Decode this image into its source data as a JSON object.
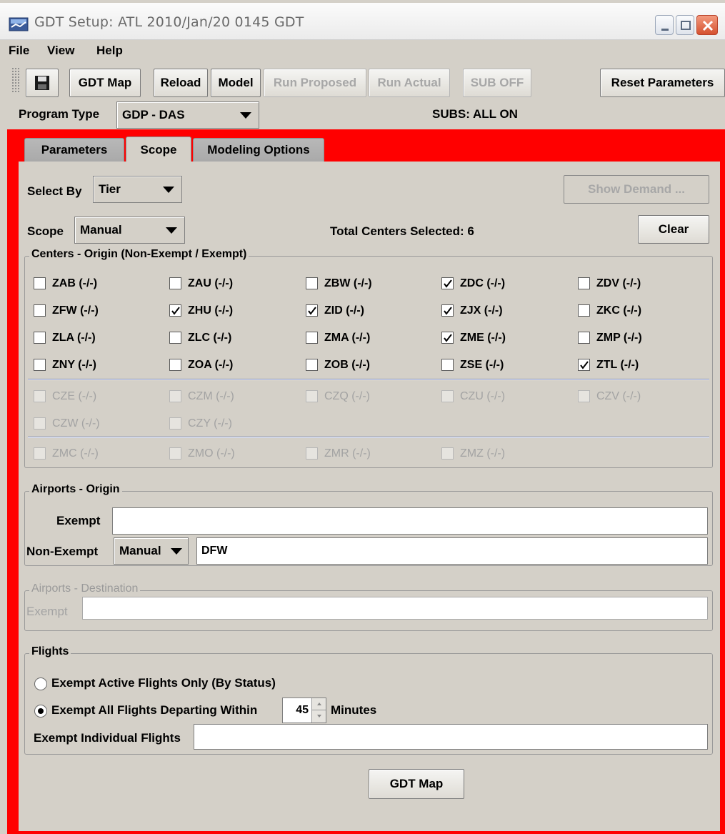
{
  "window": {
    "title": "GDT Setup: ATL 2010/Jan/20 0145 GDT"
  },
  "menu": {
    "items": [
      {
        "label": "File"
      },
      {
        "label": "View"
      },
      {
        "label": "Help"
      }
    ]
  },
  "toolbar": {
    "save_icon": "floppy-disk-icon",
    "gdt_map": "GDT Map",
    "reload": "Reload",
    "model": "Model",
    "run_proposed": "Run Proposed",
    "run_actual": "Run Actual",
    "sub_off": "SUB OFF",
    "reset_parameters": "Reset Parameters"
  },
  "program": {
    "label": "Program Type",
    "value": "GDP - DAS",
    "subs_status": "SUBS: ALL ON"
  },
  "tabs": [
    {
      "label": "Parameters",
      "active": false
    },
    {
      "label": "Scope",
      "active": true
    },
    {
      "label": "Modeling Options",
      "active": false
    }
  ],
  "scope": {
    "select_by_label": "Select By",
    "select_by_value": "Tier",
    "show_demand": "Show Demand ...",
    "scope_label": "Scope",
    "scope_value": "Manual",
    "total_centers": "Total Centers Selected: 6",
    "clear": "Clear"
  },
  "centers": {
    "title": "Centers - Origin (Non-Exempt / Exempt)",
    "items": [
      {
        "label": "ZAB (-/-)",
        "checked": false,
        "enabled": true
      },
      {
        "label": "ZAU (-/-)",
        "checked": false,
        "enabled": true
      },
      {
        "label": "ZBW (-/-)",
        "checked": false,
        "enabled": true
      },
      {
        "label": "ZDC (-/-)",
        "checked": true,
        "enabled": true
      },
      {
        "label": "ZDV (-/-)",
        "checked": false,
        "enabled": true
      },
      {
        "label": "ZFW (-/-)",
        "checked": false,
        "enabled": true
      },
      {
        "label": "ZHU (-/-)",
        "checked": true,
        "enabled": true
      },
      {
        "label": "ZID (-/-)",
        "checked": true,
        "enabled": true
      },
      {
        "label": "ZJX (-/-)",
        "checked": true,
        "enabled": true
      },
      {
        "label": "ZKC (-/-)",
        "checked": false,
        "enabled": true
      },
      {
        "label": "ZLA (-/-)",
        "checked": false,
        "enabled": true
      },
      {
        "label": "ZLC (-/-)",
        "checked": false,
        "enabled": true
      },
      {
        "label": "ZMA (-/-)",
        "checked": false,
        "enabled": true
      },
      {
        "label": "ZME (-/-)",
        "checked": true,
        "enabled": true
      },
      {
        "label": "ZMP (-/-)",
        "checked": false,
        "enabled": true
      },
      {
        "label": "ZNY (-/-)",
        "checked": false,
        "enabled": true
      },
      {
        "label": "ZOA (-/-)",
        "checked": false,
        "enabled": true
      },
      {
        "label": "ZOB (-/-)",
        "checked": false,
        "enabled": true
      },
      {
        "label": "ZSE (-/-)",
        "checked": false,
        "enabled": true
      },
      {
        "label": "ZTL (-/-)",
        "checked": true,
        "enabled": true
      },
      {
        "label": "CZE (-/-)",
        "checked": false,
        "enabled": false
      },
      {
        "label": "CZM (-/-)",
        "checked": false,
        "enabled": false
      },
      {
        "label": "CZQ (-/-)",
        "checked": false,
        "enabled": false
      },
      {
        "label": "CZU (-/-)",
        "checked": false,
        "enabled": false
      },
      {
        "label": "CZV (-/-)",
        "checked": false,
        "enabled": false
      },
      {
        "label": "CZW (-/-)",
        "checked": false,
        "enabled": false
      },
      {
        "label": "CZY (-/-)",
        "checked": false,
        "enabled": false
      },
      {
        "label": "ZMC (-/-)",
        "checked": false,
        "enabled": false
      },
      {
        "label": "ZMO (-/-)",
        "checked": false,
        "enabled": false
      },
      {
        "label": "ZMR (-/-)",
        "checked": false,
        "enabled": false
      },
      {
        "label": "ZMZ (-/-)",
        "checked": false,
        "enabled": false
      }
    ]
  },
  "airports_origin": {
    "title": "Airports - Origin",
    "exempt_label": "Exempt",
    "exempt_value": "",
    "non_exempt_label": "Non-Exempt",
    "non_exempt_mode": "Manual",
    "non_exempt_value": "DFW"
  },
  "airports_destination": {
    "title": "Airports - Destination",
    "exempt_label": "Exempt",
    "exempt_value": ""
  },
  "flights": {
    "title": "Flights",
    "option_active": "Exempt Active Flights Only (By Status)",
    "option_all": "Exempt All Flights Departing Within",
    "selected_option": "option_all",
    "minutes_value": "45",
    "minutes_label": "Minutes",
    "individual_label": "Exempt Individual Flights",
    "individual_value": ""
  },
  "footer": {
    "gdt_map": "GDT Map"
  },
  "colors": {
    "scope_frame": "#ff0000",
    "window_bg": "#d4d0c8"
  }
}
